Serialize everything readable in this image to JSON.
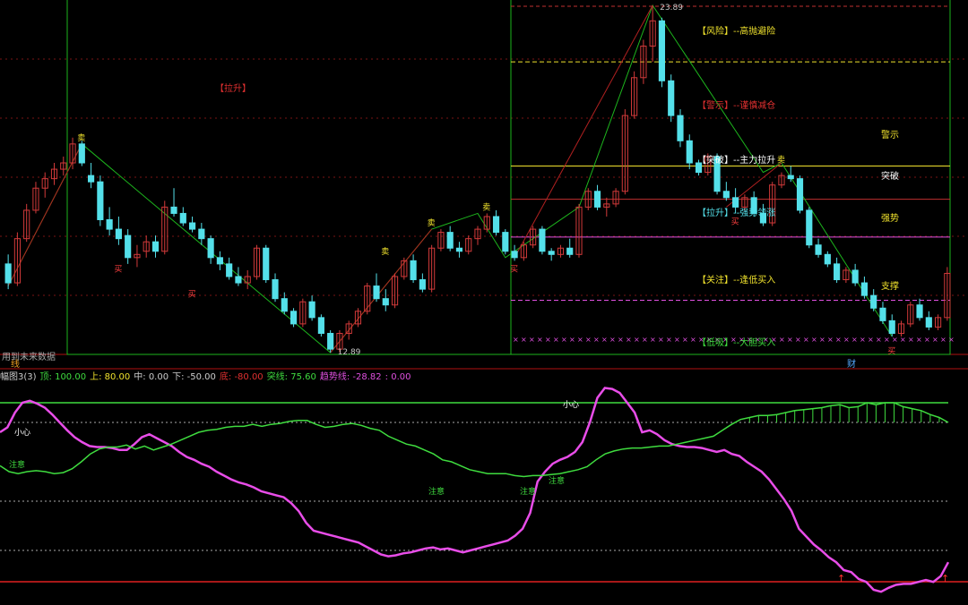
{
  "colors": {
    "up": "#d23a3a",
    "down": "#54e0ea",
    "grid_red": "#7a1515",
    "frame_green": "#1db51d",
    "indicator_line": "#e84de8",
    "green_line": "#3fdc3f",
    "yellow": "#f0e22d",
    "magenta": "#e050e0",
    "tick_gray": "#c8c8c8"
  },
  "price_panel": {
    "high_label": "23.89",
    "low_label": "12.89",
    "left_note": "用到未来数据",
    "left_badge": "线",
    "bottom_badge": "财",
    "pull_up_tag": "【拉升】",
    "zone_labels": [
      {
        "text": "【风险】--高抛避险",
        "color": "#f0e22d"
      },
      {
        "text": "【警示】--谨慎减仓",
        "color": "#e03030"
      },
      {
        "text": "【突破】--主力拉升",
        "color": "#ffffff"
      },
      {
        "text": "【拉升】--强势领涨",
        "color": "#54e0ea"
      },
      {
        "text": "【关注】--逢低买入",
        "color": "#f0e22d"
      },
      {
        "text": "【低吸】--大胆买入",
        "color": "#3fdc3f"
      }
    ],
    "right_labels": [
      {
        "text": "警示",
        "color": "#f0e22d"
      },
      {
        "text": "突破",
        "color": "#ffffff"
      },
      {
        "text": "强势",
        "color": "#f0e22d"
      },
      {
        "text": "支撑",
        "color": "#f0e22d"
      }
    ],
    "markers": {
      "sell": "卖",
      "buy": "买"
    }
  },
  "indicator_panel": {
    "legend": [
      {
        "text": "幅图3(3)",
        "color": "#cccccc"
      },
      {
        "text": "顶: 100.00",
        "color": "#3fdc3f"
      },
      {
        "text": "上: 80.00",
        "color": "#f0e22d"
      },
      {
        "text": "中: 0.00",
        "color": "#cccccc"
      },
      {
        "text": "下: -50.00",
        "color": "#cccccc"
      },
      {
        "text": "底: -80.00",
        "color": "#e03030"
      },
      {
        "text": "突线: 75.60",
        "color": "#3fdc3f"
      },
      {
        "text": "趋势线: -28.82",
        "color": "#e050e0"
      },
      {
        "text": ": 0.00",
        "color": "#e050e0"
      }
    ],
    "annotations": [
      "小心",
      "注意",
      "小心",
      "注意",
      "注意",
      "注意"
    ]
  },
  "chart_data": {
    "type": "candlestick",
    "price_range": [
      12.89,
      23.89
    ],
    "candles_ohlc": [
      [
        15.7,
        16.0,
        14.9,
        15.1
      ],
      [
        15.1,
        16.7,
        15.0,
        16.5
      ],
      [
        16.5,
        17.6,
        16.4,
        17.4
      ],
      [
        17.4,
        18.3,
        17.3,
        18.1
      ],
      [
        18.1,
        18.6,
        17.8,
        18.4
      ],
      [
        18.4,
        18.9,
        18.2,
        18.7
      ],
      [
        18.7,
        19.1,
        18.5,
        18.9
      ],
      [
        18.9,
        19.7,
        18.7,
        19.5
      ],
      [
        19.5,
        19.6,
        18.8,
        18.9
      ],
      [
        18.5,
        18.9,
        18.1,
        18.3
      ],
      [
        18.3,
        18.5,
        16.9,
        17.1
      ],
      [
        17.1,
        17.5,
        16.6,
        16.8
      ],
      [
        16.8,
        17.2,
        16.3,
        16.5
      ],
      [
        16.6,
        16.8,
        15.7,
        15.9
      ],
      [
        15.9,
        16.3,
        15.6,
        16.0
      ],
      [
        16.1,
        16.6,
        15.9,
        16.4
      ],
      [
        16.4,
        16.6,
        15.9,
        16.1
      ],
      [
        16.1,
        17.7,
        16.0,
        17.5
      ],
      [
        17.5,
        18.1,
        17.2,
        17.3
      ],
      [
        17.3,
        17.5,
        16.9,
        17.0
      ],
      [
        17.0,
        17.2,
        16.7,
        16.8
      ],
      [
        16.8,
        17.0,
        16.3,
        16.5
      ],
      [
        16.5,
        16.6,
        15.7,
        15.9
      ],
      [
        15.9,
        16.1,
        15.5,
        15.7
      ],
      [
        15.7,
        15.9,
        15.2,
        15.3
      ],
      [
        15.3,
        15.6,
        15.0,
        15.1
      ],
      [
        15.1,
        15.5,
        14.9,
        15.3
      ],
      [
        15.3,
        16.3,
        15.2,
        16.2
      ],
      [
        16.2,
        16.3,
        15.1,
        15.2
      ],
      [
        15.2,
        15.4,
        14.5,
        14.6
      ],
      [
        14.6,
        14.8,
        14.1,
        14.2
      ],
      [
        14.2,
        14.3,
        13.7,
        13.8
      ],
      [
        13.8,
        14.6,
        13.7,
        14.5
      ],
      [
        14.5,
        14.7,
        13.9,
        14.0
      ],
      [
        14.0,
        14.1,
        13.4,
        13.5
      ],
      [
        13.5,
        13.6,
        12.89,
        13.0
      ],
      [
        13.0,
        13.6,
        12.9,
        13.5
      ],
      [
        13.5,
        13.9,
        13.3,
        13.8
      ],
      [
        13.8,
        14.3,
        13.7,
        14.2
      ],
      [
        14.2,
        15.1,
        14.1,
        15.0
      ],
      [
        15.0,
        15.4,
        14.5,
        14.6
      ],
      [
        14.6,
        14.9,
        14.2,
        14.4
      ],
      [
        14.4,
        15.4,
        14.3,
        15.3
      ],
      [
        15.3,
        15.9,
        15.2,
        15.8
      ],
      [
        15.8,
        16.0,
        15.1,
        15.2
      ],
      [
        15.2,
        15.4,
        14.8,
        14.9
      ],
      [
        14.9,
        16.3,
        14.8,
        16.2
      ],
      [
        16.2,
        16.8,
        16.1,
        16.7
      ],
      [
        16.7,
        16.9,
        16.1,
        16.2
      ],
      [
        16.2,
        16.4,
        15.9,
        16.1
      ],
      [
        16.1,
        16.6,
        16.0,
        16.5
      ],
      [
        16.5,
        16.9,
        16.3,
        16.8
      ],
      [
        16.8,
        17.3,
        16.7,
        17.2
      ],
      [
        17.2,
        17.4,
        16.6,
        16.7
      ],
      [
        16.7,
        16.8,
        16.0,
        16.1
      ],
      [
        16.1,
        16.3,
        15.8,
        15.9
      ],
      [
        15.9,
        16.4,
        15.8,
        16.3
      ],
      [
        16.3,
        16.9,
        16.2,
        16.8
      ],
      [
        16.8,
        16.9,
        16.0,
        16.1
      ],
      [
        16.1,
        16.2,
        15.8,
        16.0
      ],
      [
        16.0,
        16.3,
        15.9,
        16.2
      ],
      [
        16.2,
        16.5,
        15.9,
        16.0
      ],
      [
        16.0,
        17.6,
        15.9,
        17.5
      ],
      [
        17.5,
        18.1,
        17.4,
        18.0
      ],
      [
        18.0,
        18.2,
        17.4,
        17.5
      ],
      [
        17.5,
        17.8,
        17.2,
        17.6
      ],
      [
        17.6,
        18.1,
        17.5,
        18.0
      ],
      [
        18.0,
        20.6,
        17.9,
        20.4
      ],
      [
        20.4,
        21.8,
        20.3,
        21.6
      ],
      [
        21.6,
        22.8,
        21.4,
        22.6
      ],
      [
        22.6,
        23.89,
        22.1,
        23.4
      ],
      [
        23.4,
        23.5,
        21.3,
        21.5
      ],
      [
        21.5,
        21.7,
        20.2,
        20.4
      ],
      [
        20.4,
        20.6,
        19.4,
        19.6
      ],
      [
        19.6,
        19.8,
        18.7,
        18.9
      ],
      [
        18.9,
        19.0,
        18.5,
        18.6
      ],
      [
        18.6,
        19.2,
        18.5,
        19.1
      ],
      [
        19.1,
        19.2,
        17.9,
        18.0
      ],
      [
        18.0,
        18.3,
        17.7,
        17.8
      ],
      [
        17.8,
        18.1,
        17.3,
        17.5
      ],
      [
        17.5,
        17.9,
        17.4,
        17.8
      ],
      [
        17.8,
        18.0,
        17.2,
        17.3
      ],
      [
        17.3,
        17.6,
        16.9,
        17.0
      ],
      [
        17.0,
        18.3,
        16.9,
        18.2
      ],
      [
        18.2,
        18.6,
        18.1,
        18.5
      ],
      [
        18.5,
        18.8,
        18.3,
        18.4
      ],
      [
        18.4,
        18.5,
        17.3,
        17.4
      ],
      [
        17.4,
        17.5,
        16.2,
        16.3
      ],
      [
        16.3,
        16.5,
        15.9,
        16.0
      ],
      [
        16.0,
        16.1,
        15.6,
        15.7
      ],
      [
        15.7,
        15.9,
        15.1,
        15.2
      ],
      [
        15.2,
        15.6,
        15.1,
        15.5
      ],
      [
        15.5,
        15.7,
        15.0,
        15.1
      ],
      [
        15.1,
        15.3,
        14.6,
        14.7
      ],
      [
        14.7,
        14.9,
        14.2,
        14.3
      ],
      [
        14.3,
        14.5,
        13.8,
        13.9
      ],
      [
        13.9,
        14.1,
        13.4,
        13.5
      ],
      [
        13.5,
        13.9,
        13.4,
        13.8
      ],
      [
        13.8,
        14.5,
        13.7,
        14.4
      ],
      [
        14.4,
        14.6,
        13.9,
        14.0
      ],
      [
        14.0,
        14.2,
        13.6,
        13.7
      ],
      [
        13.7,
        14.1,
        13.6,
        14.0
      ],
      [
        14.0,
        15.6,
        13.9,
        15.4
      ]
    ],
    "reference_levels": {
      "risk": 22.1,
      "warn": 18.8,
      "breakout": 17.75,
      "strong": 16.55,
      "support": 14.55,
      "low_buy": 13.32
    },
    "indicator": {
      "ylim": [
        -100,
        120
      ],
      "levels": {
        "top": 100,
        "upper": 80,
        "mid": 0,
        "lower": -50,
        "bottom": -80
      },
      "trend_line": [
        70,
        75,
        90,
        100,
        102,
        99,
        95,
        88,
        80,
        72,
        65,
        60,
        56,
        55,
        55,
        54,
        52,
        52,
        58,
        65,
        68,
        64,
        60,
        56,
        50,
        45,
        42,
        38,
        35,
        30,
        26,
        22,
        19,
        17,
        14,
        10,
        8,
        6,
        4,
        -2,
        -10,
        -22,
        -30,
        -32,
        -34,
        -36,
        -38,
        -40,
        -42,
        -46,
        -50,
        -54,
        -56,
        -55,
        -53,
        -52,
        -50,
        -48,
        -47,
        -49,
        -48,
        -50,
        -52,
        -50,
        -48,
        -46,
        -44,
        -42,
        -40,
        -35,
        -28,
        -12,
        20,
        30,
        38,
        42,
        45,
        50,
        60,
        80,
        105,
        115,
        114,
        110,
        100,
        90,
        70,
        72,
        68,
        62,
        58,
        56,
        55,
        55,
        54,
        52,
        50,
        52,
        48,
        46,
        40,
        35,
        30,
        22,
        12,
        2,
        -10,
        -28,
        -36,
        -44,
        -50,
        -57,
        -62,
        -70,
        -72,
        -79,
        -82,
        -90,
        -92,
        -88,
        -85,
        -84,
        -84,
        -82,
        -80,
        -82,
        -76,
        -62
      ],
      "breakout_line": [
        36,
        30,
        28,
        30,
        31,
        30,
        28,
        29,
        33,
        40,
        48,
        53,
        55,
        55,
        57,
        53,
        56,
        52,
        55,
        58,
        62,
        66,
        70,
        72,
        73,
        75,
        76,
        76,
        78,
        76,
        78,
        79,
        81,
        82,
        82,
        78,
        75,
        76,
        78,
        79,
        77,
        74,
        72,
        66,
        62,
        58,
        56,
        52,
        48,
        42,
        40,
        36,
        32,
        30,
        28,
        28,
        28,
        26,
        25,
        26,
        26,
        27,
        28,
        30,
        32,
        35,
        42,
        48,
        51,
        53,
        54,
        54,
        55,
        56,
        56,
        58,
        60,
        62,
        64,
        66,
        72,
        78,
        83,
        85,
        87,
        87,
        88,
        90,
        92,
        93,
        94,
        95,
        97,
        98,
        95,
        96,
        100,
        98,
        100,
        100,
        96,
        94,
        92,
        88,
        85,
        80
      ]
    }
  }
}
